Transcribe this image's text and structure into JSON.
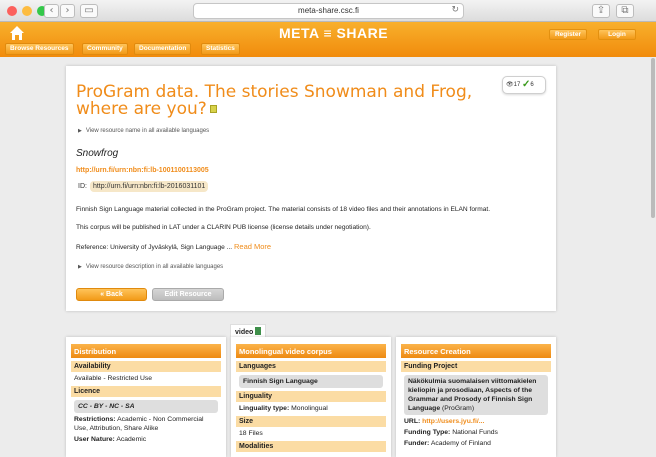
{
  "browser": {
    "url": "meta-share.csc.fi"
  },
  "header": {
    "logo": "META ≡ SHARE",
    "nav": [
      "Browse Resources",
      "Community",
      "Documentation",
      "Statistics"
    ],
    "register": "Register",
    "login": "Login"
  },
  "resource": {
    "title": "ProGram data. The stories Snowman and Frog, where are you?",
    "stats_views": "17",
    "stats_downloads": "6",
    "view_name_link": "View resource name in all available languages",
    "subtitle": "Snowfrog",
    "urn": "http://urn.fi/urn:nbn:fi:lb-1001100113005",
    "id_label": "ID:",
    "id_value": "http://urn.fi/urn:nbn:fi:lb-2016031101",
    "desc1": "Finnish Sign Language material collected in the ProGram project. The material consists of 18 video files and their annotations in ELAN format.",
    "desc2": "This corpus will be published in LAT under a CLARIN PUB license (license details under negotiation).",
    "desc3": "Reference: University of Jyväskylä, Sign Language ...",
    "read_more": "Read More",
    "view_desc_link": "View resource description in all available languages",
    "back_label": "« Back",
    "edit_label": "Edit Resource"
  },
  "video_tab": "video",
  "distribution": {
    "title": "Distribution",
    "availability_label": "Availability",
    "availability_value": "Available - Restricted Use",
    "licence_label": "Licence",
    "licence_value": "CC - BY - NC - SA",
    "restrictions_label": "Restrictions:",
    "restrictions_value": "Academic - Non Commercial Use, Attribution, Share Alike",
    "user_nature_label": "User Nature:",
    "user_nature_value": "Academic"
  },
  "corpus": {
    "title": "Monolingual video corpus",
    "languages_label": "Languages",
    "language_value": "Finnish Sign Language",
    "linguality_label": "Linguality",
    "linguality_type_label": "Linguality type:",
    "linguality_type_value": "Monolingual",
    "size_label": "Size",
    "size_value": "18 Files",
    "modalities_label": "Modalities"
  },
  "creation": {
    "title": "Resource Creation",
    "funding_label": "Funding Project",
    "project_name": "Näkökulmia suomalaisen viittomakielen kieliopin ja prosodiaan, Aspects of the Grammar and Prosody of Finnish Sign Language",
    "project_short": "(ProGram)",
    "url_label": "URL:",
    "url_value": "http://users.jyu.fi/...",
    "funding_type_label": "Funding Type:",
    "funding_type_value": "National Funds",
    "funder_label": "Funder:",
    "funder_value": "Academy of Finland"
  }
}
